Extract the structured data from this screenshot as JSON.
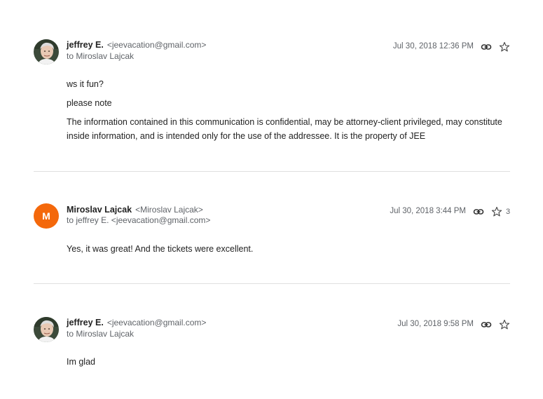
{
  "messages": [
    {
      "sender_name": "jeffrey E.",
      "sender_address": "<jeevacation@gmail.com>",
      "recipient": "to Miroslav Lajcak",
      "date": "Jul 30, 2018 12:36 PM",
      "body": [
        "ws it fun?",
        "please note",
        "The information contained in this communication is confidential, may be attorney-client privileged, may constitute inside information, and is intended only for the use of the addressee. It is the property of JEE"
      ]
    },
    {
      "avatar_letter": "M",
      "sender_name": "Miroslav Lajcak",
      "sender_address": "<Miroslav Lajcak>",
      "recipient": "to jeffrey E. <jeevacation@gmail.com>",
      "date": "Jul 30, 2018 3:44 PM",
      "extra": "3",
      "body": [
        "Yes, it was great! And the tickets were excellent."
      ]
    },
    {
      "sender_name": "jeffrey E.",
      "sender_address": "<jeevacation@gmail.com>",
      "recipient": "to Miroslav Lajcak",
      "date": "Jul 30, 2018 9:58 PM",
      "body": [
        "Im glad"
      ]
    }
  ],
  "icons": {
    "link": "link-icon",
    "star": "star-icon"
  },
  "colors": {
    "avatar_orange": "#f4680b",
    "divider": "#e0e0e0",
    "meta_text": "#5f6368"
  }
}
